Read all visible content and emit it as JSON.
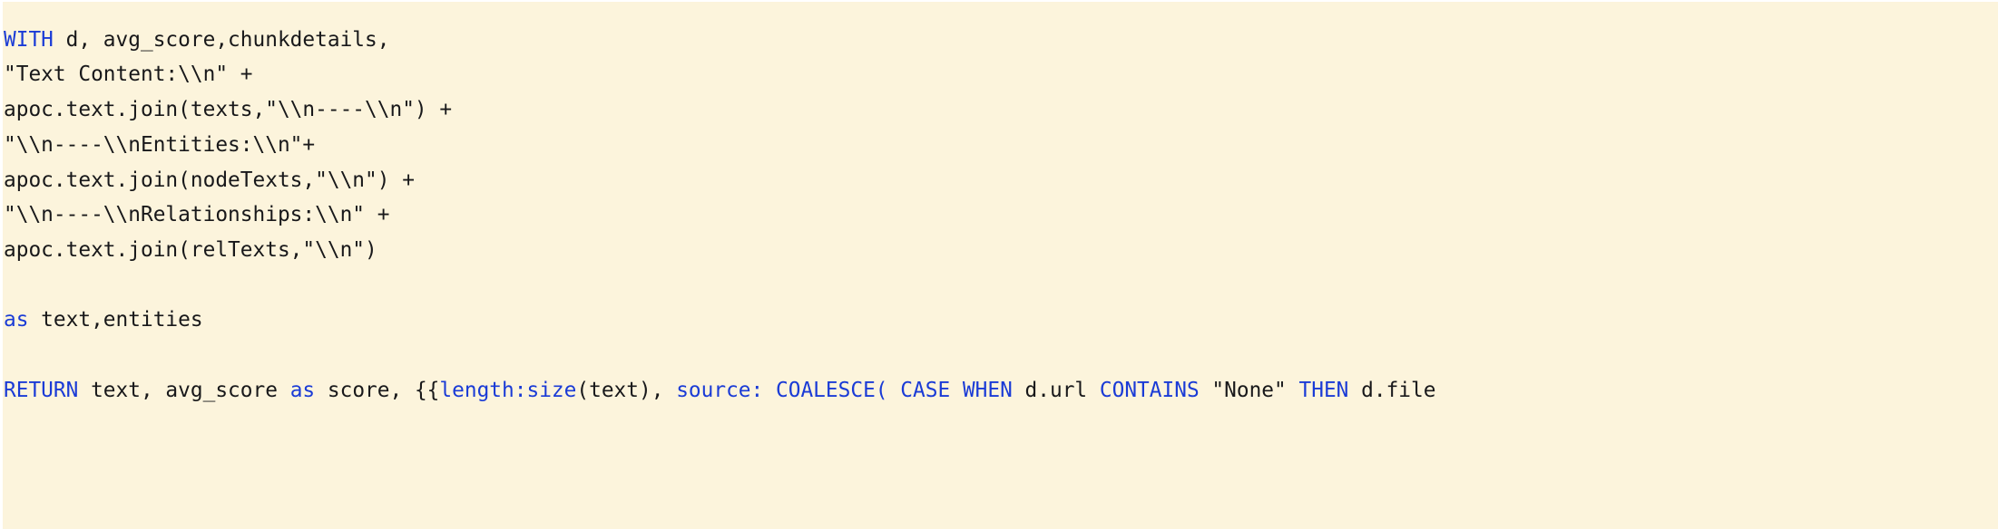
{
  "editor": {
    "name": "cypher-query-code-block",
    "language": "cypher",
    "background_color": "#FCF4DC",
    "text_color": "#18181A",
    "keyword_color": "#1A3BD6",
    "font_size_px": 22.8,
    "line_height_px": 38.7,
    "right_edge_clipped": true
  },
  "code": {
    "lines": [
      {
        "index": 0,
        "spans": [
          {
            "text": "WITH",
            "type": "keyword"
          },
          {
            "text": " d, avg_score,chunkdetails,",
            "type": "plain"
          }
        ]
      },
      {
        "index": 1,
        "spans": [
          {
            "text": "\"Text Content:\\\\n\" +",
            "type": "plain"
          }
        ]
      },
      {
        "index": 2,
        "spans": [
          {
            "text": "apoc.text.join(texts,\"\\\\n----\\\\n\") +",
            "type": "plain"
          }
        ]
      },
      {
        "index": 3,
        "spans": [
          {
            "text": "\"\\\\n----\\\\nEntities:\\\\n\"+",
            "type": "plain"
          }
        ]
      },
      {
        "index": 4,
        "spans": [
          {
            "text": "apoc.text.join(nodeTexts,\"\\\\n\") +",
            "type": "plain"
          }
        ]
      },
      {
        "index": 5,
        "spans": [
          {
            "text": "\"\\\\n----\\\\nRelationships:\\\\n\" +",
            "type": "plain"
          }
        ]
      },
      {
        "index": 6,
        "spans": [
          {
            "text": "apoc.text.join(relTexts,\"\\\\n\")",
            "type": "plain"
          }
        ]
      },
      {
        "index": 7,
        "spans": []
      },
      {
        "index": 8,
        "spans": [
          {
            "text": "as",
            "type": "keyword"
          },
          {
            "text": " text,entities",
            "type": "plain"
          }
        ]
      },
      {
        "index": 9,
        "spans": []
      },
      {
        "index": 10,
        "spans": [
          {
            "text": "RETURN",
            "type": "keyword"
          },
          {
            "text": " text, avg_score ",
            "type": "plain"
          },
          {
            "text": "as",
            "type": "keyword"
          },
          {
            "text": " score, {{",
            "type": "plain"
          },
          {
            "text": "length:size",
            "type": "keyword"
          },
          {
            "text": "(text), ",
            "type": "plain"
          },
          {
            "text": "source:",
            "type": "keyword"
          },
          {
            "text": " ",
            "type": "plain"
          },
          {
            "text": "COALESCE(",
            "type": "keyword"
          },
          {
            "text": " ",
            "type": "plain"
          },
          {
            "text": "CASE WHEN",
            "type": "keyword"
          },
          {
            "text": " d.url ",
            "type": "plain"
          },
          {
            "text": "CONTAINS",
            "type": "keyword"
          },
          {
            "text": " \"None\" ",
            "type": "plain"
          },
          {
            "text": "THEN",
            "type": "keyword"
          },
          {
            "text": " d.file",
            "type": "plain"
          }
        ]
      }
    ]
  }
}
